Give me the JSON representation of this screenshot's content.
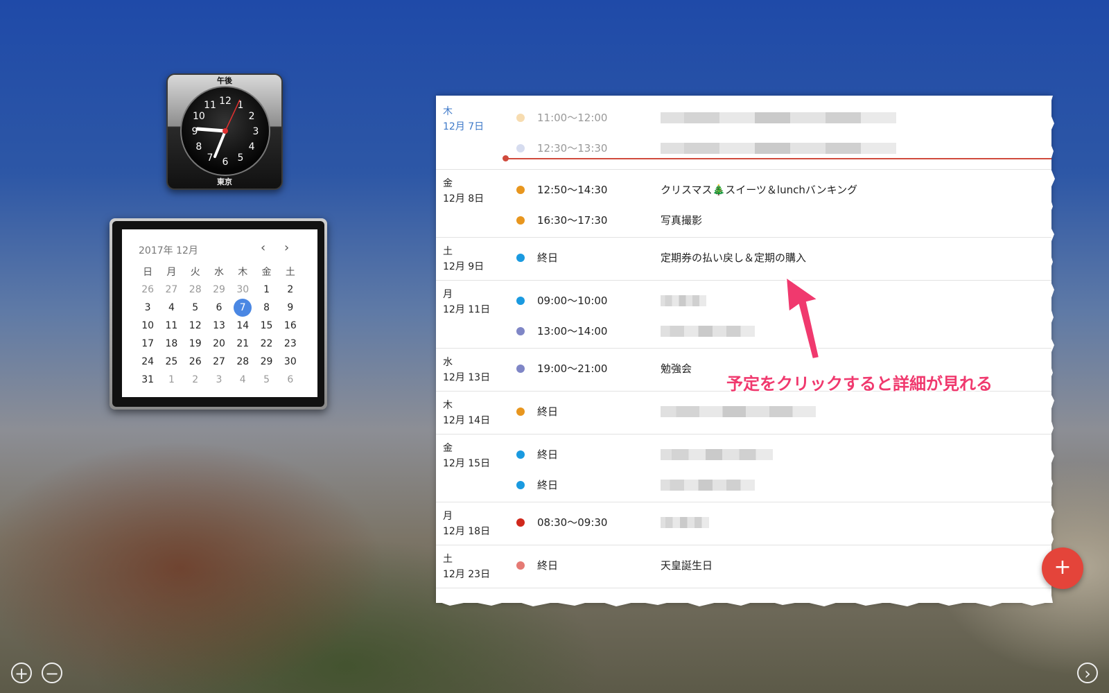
{
  "clock": {
    "top_label": "午後",
    "bottom_label": "東京",
    "numbers": [
      "12",
      "1",
      "2",
      "3",
      "4",
      "5",
      "6",
      "7",
      "8",
      "9",
      "10",
      "11"
    ]
  },
  "calendar": {
    "header": "2017年 12月",
    "prev": "‹",
    "next": "›",
    "weekdays": [
      "日",
      "月",
      "火",
      "水",
      "木",
      "金",
      "土"
    ],
    "weeks": [
      [
        "26",
        "27",
        "28",
        "29",
        "30",
        "1",
        "2"
      ],
      [
        "3",
        "4",
        "5",
        "6",
        "7",
        "8",
        "9"
      ],
      [
        "10",
        "11",
        "12",
        "13",
        "14",
        "15",
        "16"
      ],
      [
        "17",
        "18",
        "19",
        "20",
        "21",
        "22",
        "23"
      ],
      [
        "24",
        "25",
        "26",
        "27",
        "28",
        "29",
        "30"
      ],
      [
        "31",
        "1",
        "2",
        "3",
        "4",
        "5",
        "6"
      ]
    ],
    "selected": "7"
  },
  "schedule": {
    "days": [
      {
        "dow": "木",
        "date": "12月 7日",
        "events": [
          {
            "time": "11:00〜12:00",
            "color": "#f7dcb0",
            "title": ""
          },
          {
            "time": "12:30〜13:30",
            "color": "#d6dcef",
            "title": ""
          }
        ]
      },
      {
        "dow": "金",
        "date": "12月 8日",
        "events": [
          {
            "time": "12:50〜14:30",
            "color": "#e8961e",
            "title": "クリスマス🎄スイーツ＆lunchバンキング"
          },
          {
            "time": "16:30〜17:30",
            "color": "#e8961e",
            "title": "写真撮影"
          }
        ]
      },
      {
        "dow": "土",
        "date": "12月 9日",
        "events": [
          {
            "time": "終日",
            "color": "#1a9ae0",
            "title": "定期券の払い戻し＆定期の購入"
          }
        ]
      },
      {
        "dow": "月",
        "date": "12月 11日",
        "events": [
          {
            "time": "09:00〜10:00",
            "color": "#1a9ae0",
            "title": ""
          },
          {
            "time": "13:00〜14:00",
            "color": "#7f86c6",
            "title": ""
          }
        ]
      },
      {
        "dow": "水",
        "date": "12月 13日",
        "events": [
          {
            "time": "19:00〜21:00",
            "color": "#7f86c6",
            "title": "勉強会"
          }
        ]
      },
      {
        "dow": "木",
        "date": "12月 14日",
        "events": [
          {
            "time": "終日",
            "color": "#e8961e",
            "title": ""
          }
        ]
      },
      {
        "dow": "金",
        "date": "12月 15日",
        "events": [
          {
            "time": "終日",
            "color": "#1a9ae0",
            "title": ""
          },
          {
            "time": "終日",
            "color": "#1a9ae0",
            "title": ""
          }
        ]
      },
      {
        "dow": "月",
        "date": "12月 18日",
        "events": [
          {
            "time": "08:30〜09:30",
            "color": "#d0281c",
            "title": ""
          }
        ]
      },
      {
        "dow": "土",
        "date": "12月 23日",
        "events": [
          {
            "time": "終日",
            "color": "#e57a74",
            "title": "天皇誕生日"
          }
        ]
      }
    ]
  },
  "annotation": "予定をクリックすると詳細が見れる",
  "fab_label": "+",
  "bottom": {
    "add": "+",
    "remove": "−",
    "next": "›"
  }
}
